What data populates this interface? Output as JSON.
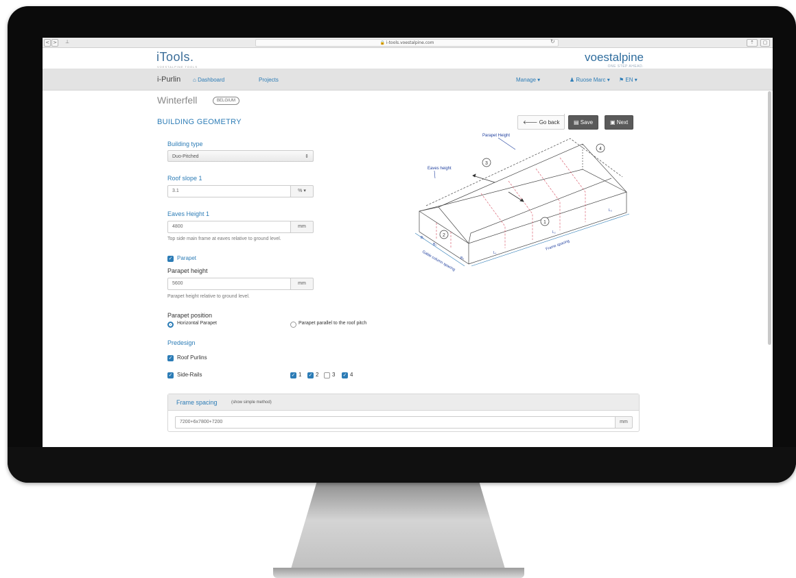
{
  "browser": {
    "url": "i-tools.voestalpine.com",
    "back": "<",
    "forward": ">",
    "share": "⊥"
  },
  "header": {
    "logo": "iTools.",
    "logo_sub": "VOESTALPINE TOOLS",
    "brand": "voestalpine",
    "brand_tag": "ONE STEP AHEAD."
  },
  "nav": {
    "app": "i-Purlin",
    "dashboard": "Dashboard",
    "projects": "Projects",
    "manage": "Manage",
    "user": "Ruose Marc",
    "language": "EN"
  },
  "project": {
    "name": "Winterfell",
    "country": "BELGIUM"
  },
  "section": {
    "title": "BUILDING GEOMETRY"
  },
  "buttons": {
    "go_back": "Go back",
    "save": "Save",
    "next": "Next"
  },
  "form": {
    "building_type_label": "Building type",
    "building_type_value": "Duo-Pitched",
    "roof_slope_label": "Roof slope 1",
    "roof_slope_value": "3.1",
    "roof_slope_unit": "%",
    "eaves_label": "Eaves Height 1",
    "eaves_value": "4800",
    "eaves_unit": "mm",
    "eaves_help": "Top side main frame at eaves relative to ground level.",
    "parapet_checkbox": "Parapet",
    "parapet_height_label": "Parapet height",
    "parapet_height_value": "5600",
    "parapet_height_unit": "mm",
    "parapet_help": "Parapet height relative to ground level.",
    "parapet_position_label": "Parapet position",
    "radio_horizontal": "Horizontal Parapet",
    "radio_parallel": "Parapet parallel to the roof pitch",
    "predesign_label": "Predesign",
    "roof_purlins": "Roof Purlins",
    "side_rails": "Side-Rails",
    "side_options": [
      "1",
      "2",
      "3",
      "4"
    ],
    "side_checked": [
      true,
      true,
      false,
      true
    ]
  },
  "frame_spacing": {
    "title": "Frame spacing",
    "subtitle": "(show simple method)",
    "value": "7200+6x7800+7200",
    "unit": "mm"
  },
  "diagram": {
    "parapet_height": "Parapet Height",
    "eaves_height": "Eaves height",
    "gable_spacing": "Gable column spacing",
    "frame_spacing": "Frame spacing",
    "markers": [
      "1",
      "2",
      "3",
      "4"
    ],
    "dims": [
      "B₁",
      "B₂",
      "B₃",
      "L₁",
      "L₂",
      "L₃"
    ]
  },
  "colors": {
    "accent": "#2c7cb6",
    "dark_button": "#5a5a5a",
    "navbar": "#e3e3e3"
  }
}
